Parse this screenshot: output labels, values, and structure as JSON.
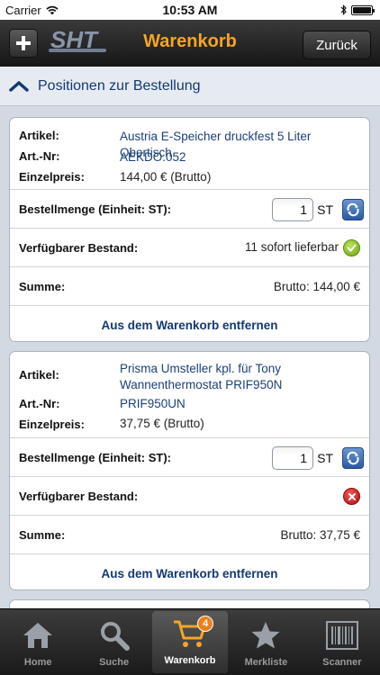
{
  "status_bar": {
    "carrier": "Carrier",
    "time": "10:53 AM"
  },
  "nav": {
    "title": "Warenkorb",
    "back_label": "Zurück",
    "logo_text": "SHT"
  },
  "section": {
    "title": "Positionen zur Bestellung"
  },
  "labels": {
    "artikel": "Artikel:",
    "artnr": "Art.-Nr:",
    "einzelpreis": "Einzelpreis:",
    "bestellmenge": "Bestellmenge (Einheit: ST):",
    "bestand": "Verfügbarer Bestand:",
    "summe": "Summe:",
    "remove": "Aus dem Warenkorb entfernen"
  },
  "items": [
    {
      "name": "Austria E-Speicher druckfest 5 Liter Obertisch",
      "artnr": "AEKDO.052",
      "price": "144,00 € (Brutto)",
      "quantity": "1",
      "unit": "ST",
      "stock_text": "11 sofort lieferbar",
      "stock_status": "available",
      "sum": "Brutto: 144,00 €"
    },
    {
      "name": "Prisma Umsteller kpl. für Tony Wannenthermostat PRIF950N",
      "artnr": "PRIF950UN",
      "price": "37,75 € (Brutto)",
      "quantity": "1",
      "unit": "ST",
      "stock_text": "",
      "stock_status": "unavailable",
      "sum": "Brutto: 37,75 €"
    }
  ],
  "tabs": [
    {
      "label": "Home",
      "icon": "home-icon"
    },
    {
      "label": "Suche",
      "icon": "search-icon"
    },
    {
      "label": "Warenkorb",
      "icon": "cart-icon",
      "badge": "4",
      "active": true
    },
    {
      "label": "Merkliste",
      "icon": "star-icon"
    },
    {
      "label": "Scanner",
      "icon": "barcode-icon"
    }
  ],
  "colors": {
    "accent": "#f5a623",
    "link": "#1a3f7a",
    "badge": "#f07f1a"
  }
}
